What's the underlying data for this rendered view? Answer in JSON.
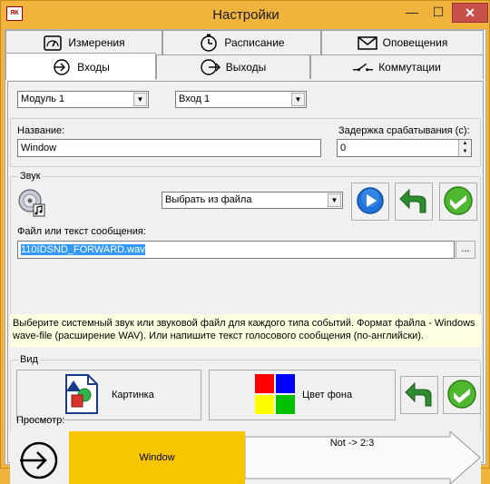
{
  "window": {
    "app_icon_text": "ЯК",
    "title": "Настройки",
    "min_glyph": "—",
    "max_glyph": "☐",
    "close_glyph": "✕"
  },
  "tabs_top": [
    {
      "label": "Измерения",
      "icon": "gauge-icon"
    },
    {
      "label": "Расписание",
      "icon": "clock-icon"
    },
    {
      "label": "Оповещения",
      "icon": "envelope-icon"
    }
  ],
  "tabs_bottom": [
    {
      "label": "Входы",
      "icon": "enter-icon",
      "active": true
    },
    {
      "label": "Выходы",
      "icon": "exit-icon",
      "active": false
    },
    {
      "label": "Коммутации",
      "icon": "switch-icon",
      "active": false
    }
  ],
  "selectors": {
    "module": "Модуль 1",
    "input": "Вход 1"
  },
  "name_field": {
    "label": "Название:",
    "value": "Window"
  },
  "delay_field": {
    "label": "Задержка срабатывания (с):",
    "value": "0"
  },
  "sound": {
    "group_title": "Звук",
    "source_option": "Выбрать из файла",
    "file_label": "Файл или текст сообщения:",
    "file_value": "110IDSND_FORWARD.wav",
    "browse_label": "...",
    "hint": "Выберите системный звук или звуковой файл для каждого типа событий. Формат файла - Windows wave-file (расширение WAV). Или напишите текст голосового сообщения (по-английски)."
  },
  "view": {
    "group_title": "Вид",
    "picture_label": "Картинка",
    "bgcolor_label": "Цвет фона",
    "preview_label": "Просмотр:",
    "preview_name": "Window",
    "preview_route": "Not -> 2:3"
  },
  "colors": {
    "accent_orange": "#f0b43c",
    "preview_yellow": "#f7c600",
    "play_blue": "#1f73d8",
    "check_green": "#4db82e",
    "close_red": "#c7504b"
  }
}
